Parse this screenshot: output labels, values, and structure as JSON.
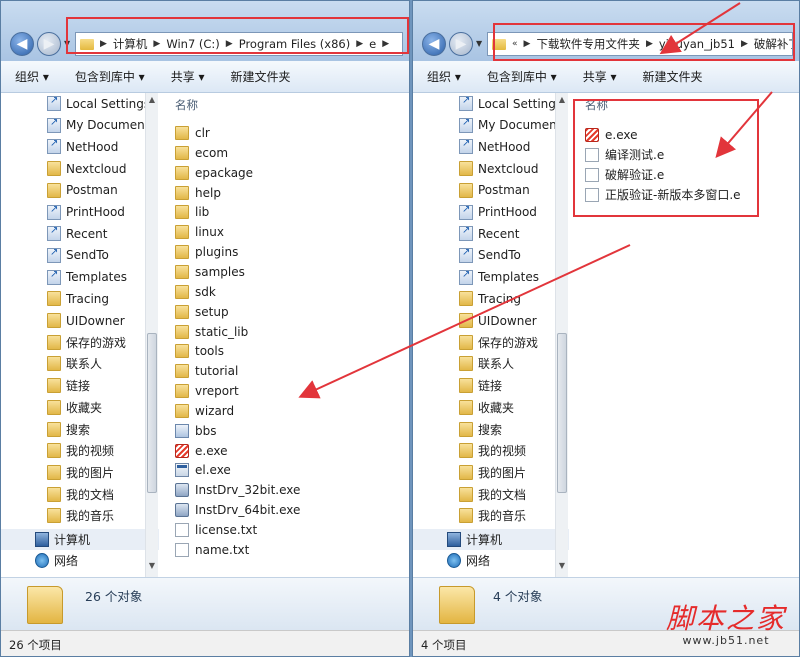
{
  "left_window": {
    "address": [
      "计算机",
      "Win7 (C:)",
      "Program Files (x86)",
      "e"
    ],
    "toolbar": [
      "组织 ▾",
      "包含到库中 ▾",
      "共享 ▾",
      "新建文件夹"
    ],
    "column_header": "名称",
    "files": [
      {
        "name": "clr",
        "icon": "folder-icon"
      },
      {
        "name": "ecom",
        "icon": "folder-icon"
      },
      {
        "name": "epackage",
        "icon": "folder-icon"
      },
      {
        "name": "help",
        "icon": "folder-icon"
      },
      {
        "name": "lib",
        "icon": "folder-icon"
      },
      {
        "name": "linux",
        "icon": "folder-icon"
      },
      {
        "name": "plugins",
        "icon": "folder-icon"
      },
      {
        "name": "samples",
        "icon": "folder-icon"
      },
      {
        "name": "sdk",
        "icon": "folder-icon"
      },
      {
        "name": "setup",
        "icon": "folder-icon"
      },
      {
        "name": "static_lib",
        "icon": "folder-icon"
      },
      {
        "name": "tools",
        "icon": "folder-icon"
      },
      {
        "name": "tutorial",
        "icon": "folder-icon"
      },
      {
        "name": "vreport",
        "icon": "folder-icon"
      },
      {
        "name": "wizard",
        "icon": "folder-icon"
      },
      {
        "name": "bbs",
        "icon": "shortcut-icon"
      },
      {
        "name": "e.exe",
        "icon": "e-exe-icon"
      },
      {
        "name": "el.exe",
        "icon": "exe-icon"
      },
      {
        "name": "InstDrv_32bit.exe",
        "icon": "installer-icon"
      },
      {
        "name": "InstDrv_64bit.exe",
        "icon": "installer-icon"
      },
      {
        "name": "license.txt",
        "icon": "text-file-icon"
      },
      {
        "name": "name.txt",
        "icon": "text-file-icon"
      }
    ],
    "object_count": "26 个对象",
    "status_text": "26 个项目"
  },
  "right_window": {
    "address_prefix": "«",
    "address": [
      "下载软件专用文件夹",
      "yiyuyan_jb51",
      "破解补丁"
    ],
    "toolbar": [
      "组织 ▾",
      "包含到库中 ▾",
      "共享 ▾",
      "新建文件夹"
    ],
    "column_header": "名称",
    "files": [
      {
        "name": "e.exe",
        "icon": "e-exe-icon"
      },
      {
        "name": "编译测试.e",
        "icon": "text-file-icon"
      },
      {
        "name": "破解验证.e",
        "icon": "text-file-icon"
      },
      {
        "name": "正版验证-新版本多窗口.e",
        "icon": "text-file-icon"
      }
    ],
    "object_count": "4 个对象",
    "status_text": "4 个项目"
  },
  "nav_items": [
    {
      "label": "Local Settings",
      "icon": "shortcut-folder-icon"
    },
    {
      "label": "My Documents",
      "icon": "shortcut-folder-icon"
    },
    {
      "label": "NetHood",
      "icon": "shortcut-folder-icon"
    },
    {
      "label": "Nextcloud",
      "icon": "folder-icon"
    },
    {
      "label": "Postman",
      "icon": "folder-icon"
    },
    {
      "label": "PrintHood",
      "icon": "shortcut-folder-icon"
    },
    {
      "label": "Recent",
      "icon": "shortcut-folder-icon"
    },
    {
      "label": "SendTo",
      "icon": "shortcut-folder-icon"
    },
    {
      "label": "Templates",
      "icon": "shortcut-folder-icon"
    },
    {
      "label": "Tracing",
      "icon": "folder-icon"
    },
    {
      "label": "UIDowner",
      "icon": "folder-icon"
    },
    {
      "label": "保存的游戏",
      "icon": "games-folder-icon"
    },
    {
      "label": "联系人",
      "icon": "contacts-folder-icon"
    },
    {
      "label": "链接",
      "icon": "links-folder-icon"
    },
    {
      "label": "收藏夹",
      "icon": "favorites-folder-icon"
    },
    {
      "label": "搜索",
      "icon": "search-folder-icon"
    },
    {
      "label": "我的视频",
      "icon": "videos-folder-icon"
    },
    {
      "label": "我的图片",
      "icon": "pictures-folder-icon"
    },
    {
      "label": "我的文档",
      "icon": "documents-folder-icon"
    },
    {
      "label": "我的音乐",
      "icon": "music-folder-icon"
    }
  ],
  "nav_roots": [
    {
      "label": "计算机",
      "icon": "computer-icon"
    },
    {
      "label": "网络",
      "icon": "network-icon"
    }
  ],
  "watermark": {
    "big": "脚本之家",
    "small": "www.jb51.net"
  },
  "colors": {
    "annotation_red": "#e2353b",
    "watermark_red": "#e52b2b"
  }
}
